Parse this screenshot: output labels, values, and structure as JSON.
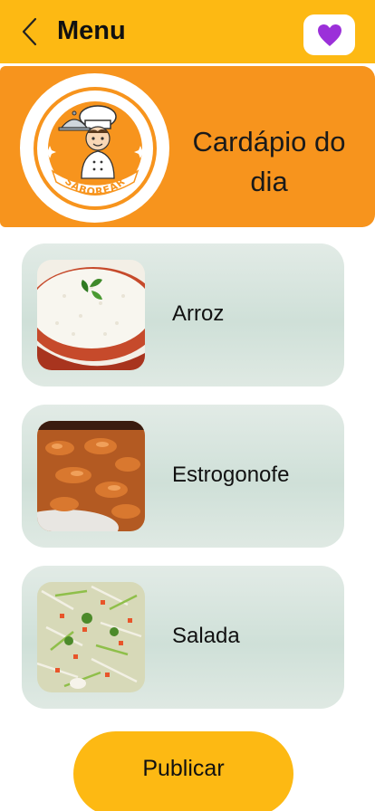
{
  "header": {
    "title": "Menu",
    "back_icon": "chevron-left-icon",
    "favorite_icon": "heart-icon",
    "accent_color": "#FDB913",
    "heart_color": "#9B30D9"
  },
  "hero": {
    "background_color": "#F7941D",
    "brand_name": "SABOREAR",
    "title": "Cardápio do dia"
  },
  "menu_items": [
    {
      "label": "Arroz",
      "image": "rice-image"
    },
    {
      "label": "Estrogonofe",
      "image": "stroganoff-image"
    },
    {
      "label": "Salada",
      "image": "salad-image"
    }
  ],
  "actions": {
    "publish_label": "Publicar"
  }
}
